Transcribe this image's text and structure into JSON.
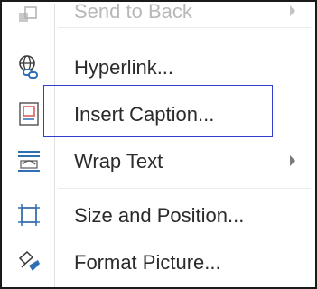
{
  "menu": {
    "items": [
      {
        "label": "Send to Back",
        "icon": "send-to-back-icon",
        "submenu": true,
        "faded": true
      },
      {
        "label": "Hyperlink...",
        "icon": "hyperlink-globe-icon",
        "submenu": false
      },
      {
        "label": "Insert Caption...",
        "icon": "insert-caption-icon",
        "submenu": false,
        "highlighted": true
      },
      {
        "label": "Wrap Text",
        "icon": "wrap-text-icon",
        "submenu": true
      },
      {
        "label": "Size and Position...",
        "icon": "size-position-icon",
        "submenu": false
      },
      {
        "label": "Format Picture...",
        "icon": "format-picture-brush-icon",
        "submenu": false
      }
    ]
  },
  "colors": {
    "highlight_border": "#2f3fd0",
    "icon_blue": "#2f6fb3",
    "text": "#2b2b2b"
  }
}
